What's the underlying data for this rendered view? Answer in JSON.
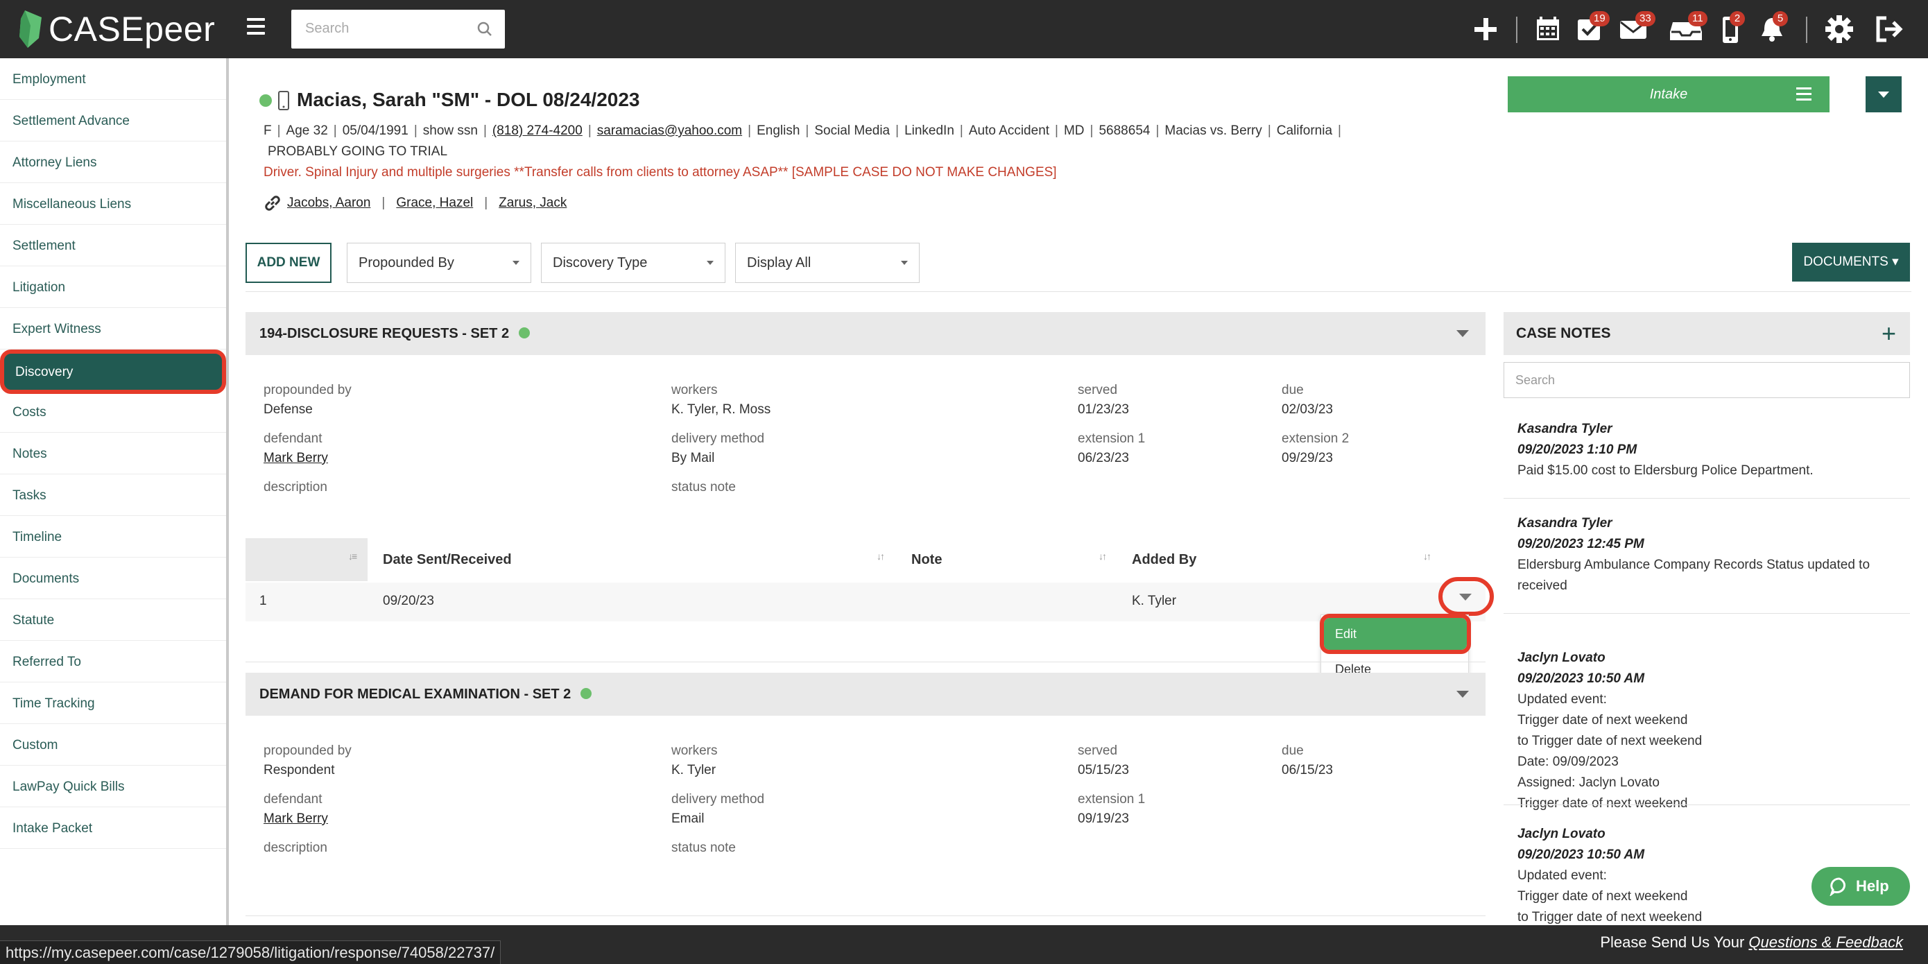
{
  "app": {
    "brand": "CASEpeer",
    "search_placeholder": "Search",
    "badges": {
      "tasks": "19",
      "mail": "33",
      "inbox": "11",
      "phone": "2",
      "alerts": "5"
    },
    "colors": {
      "topbar": "#2b2b2b",
      "brand_green": "#215a52",
      "accent_green": "#4caa62",
      "alert_red": "#c33d2a",
      "highlight": "#e53b2a"
    }
  },
  "sidebar": {
    "items": [
      {
        "label": "Employment"
      },
      {
        "label": "Settlement Advance"
      },
      {
        "label": "Attorney Liens"
      },
      {
        "label": "Miscellaneous Liens"
      },
      {
        "label": "Settlement"
      },
      {
        "label": "Litigation"
      },
      {
        "label": "Expert Witness"
      },
      {
        "label": "Discovery"
      },
      {
        "label": "Costs"
      },
      {
        "label": "Notes"
      },
      {
        "label": "Tasks"
      },
      {
        "label": "Timeline"
      },
      {
        "label": "Documents"
      },
      {
        "label": "Statute"
      },
      {
        "label": "Referred To"
      },
      {
        "label": "Time Tracking"
      },
      {
        "label": "Custom"
      },
      {
        "label": "LawPay Quick Bills"
      },
      {
        "label": "Intake Packet"
      }
    ],
    "active": "Discovery"
  },
  "case": {
    "name": "Macias, Sarah \"SM\" - DOL 08/24/2023",
    "sex": "F",
    "age": "Age 32",
    "dob": "05/04/1991",
    "ssn": "show ssn",
    "phone": "(818) 274-4200",
    "email": "saramacias@yahoo.com",
    "language": "English",
    "source": "Social Media",
    "referral": "LinkedIn",
    "case_type": "Auto Accident",
    "state_code": "MD",
    "case_number": "5688654",
    "caption": "Macias vs. Berry",
    "jurisdiction": "California",
    "outlook": "PROBABLY GOING TO TRIAL",
    "alert": "Driver. Spinal Injury and multiple surgeries **Transfer calls from clients to attorney ASAP** [SAMPLE CASE DO NOT MAKE CHANGES]",
    "staff": [
      "Jacobs, Aaron",
      "Grace, Hazel",
      "Zarus, Jack"
    ],
    "status_label": "Intake"
  },
  "toolbar": {
    "add_new": "ADD NEW",
    "propounded_by": "Propounded By",
    "discovery_type": "Discovery Type",
    "display": "Display All",
    "documents": "DOCUMENTS"
  },
  "discovery": [
    {
      "title": "194-DISCLOSURE REQUESTS - SET 2",
      "labels": {
        "propounded_by": "propounded by",
        "workers": "workers",
        "served": "served",
        "due": "due",
        "defendant": "defendant",
        "delivery_method": "delivery method",
        "extension_1": "extension 1",
        "extension_2": "extension 2",
        "description": "description",
        "status_note": "status note"
      },
      "propounded_by": "Defense",
      "workers": "K. Tyler, R. Moss",
      "served": "01/23/23",
      "due": "02/03/23",
      "defendant": "Mark Berry",
      "delivery_method": "By Mail",
      "extension_1": "06/23/23",
      "extension_2": "09/29/23",
      "table": {
        "headers": [
          "Date Sent/Received",
          "Note",
          "Added By"
        ],
        "rows": [
          {
            "num": "1",
            "date": "09/20/23",
            "note": "",
            "added_by": "K. Tyler"
          }
        ]
      },
      "menu": {
        "edit": "Edit",
        "delete": "Delete"
      }
    },
    {
      "title": "DEMAND FOR MEDICAL EXAMINATION - SET 2",
      "propounded_by": "Respondent",
      "workers": "K. Tyler",
      "served": "05/15/23",
      "due": "06/15/23",
      "defendant": "Mark Berry",
      "delivery_method": "Email",
      "extension_1": "09/19/23"
    }
  ],
  "case_notes": {
    "title": "CASE NOTES",
    "search_placeholder": "Search",
    "notes": [
      {
        "author": "Kasandra Tyler",
        "when": "09/20/2023 1:10 PM",
        "lines": [
          "Paid $15.00 cost to Eldersburg Police Department."
        ]
      },
      {
        "author": "Kasandra Tyler",
        "when": "09/20/2023 12:45 PM",
        "lines": [
          "Eldersburg Ambulance Company Records Status updated to",
          "received"
        ]
      },
      {
        "author": "Jaclyn Lovato",
        "when": "09/20/2023 10:50 AM",
        "lines": [
          "Updated event:",
          "Trigger date of next weekend",
          "to Trigger date of next weekend",
          "Date: 09/09/2023",
          "Assigned: Jaclyn Lovato",
          "Trigger date of next weekend"
        ]
      },
      {
        "author": "Jaclyn Lovato",
        "when": "09/20/2023 10:50 AM",
        "lines": [
          "Updated event:",
          "Trigger date of next weekend",
          "to Trigger date of next weekend"
        ]
      }
    ]
  },
  "help": "Help",
  "footer": {
    "url": "https://my.casepeer.com/case/1279058/litigation/response/74058/22737/",
    "feedback_prefix": "Please Send Us Your",
    "feedback_link": "Questions & Feedback"
  }
}
